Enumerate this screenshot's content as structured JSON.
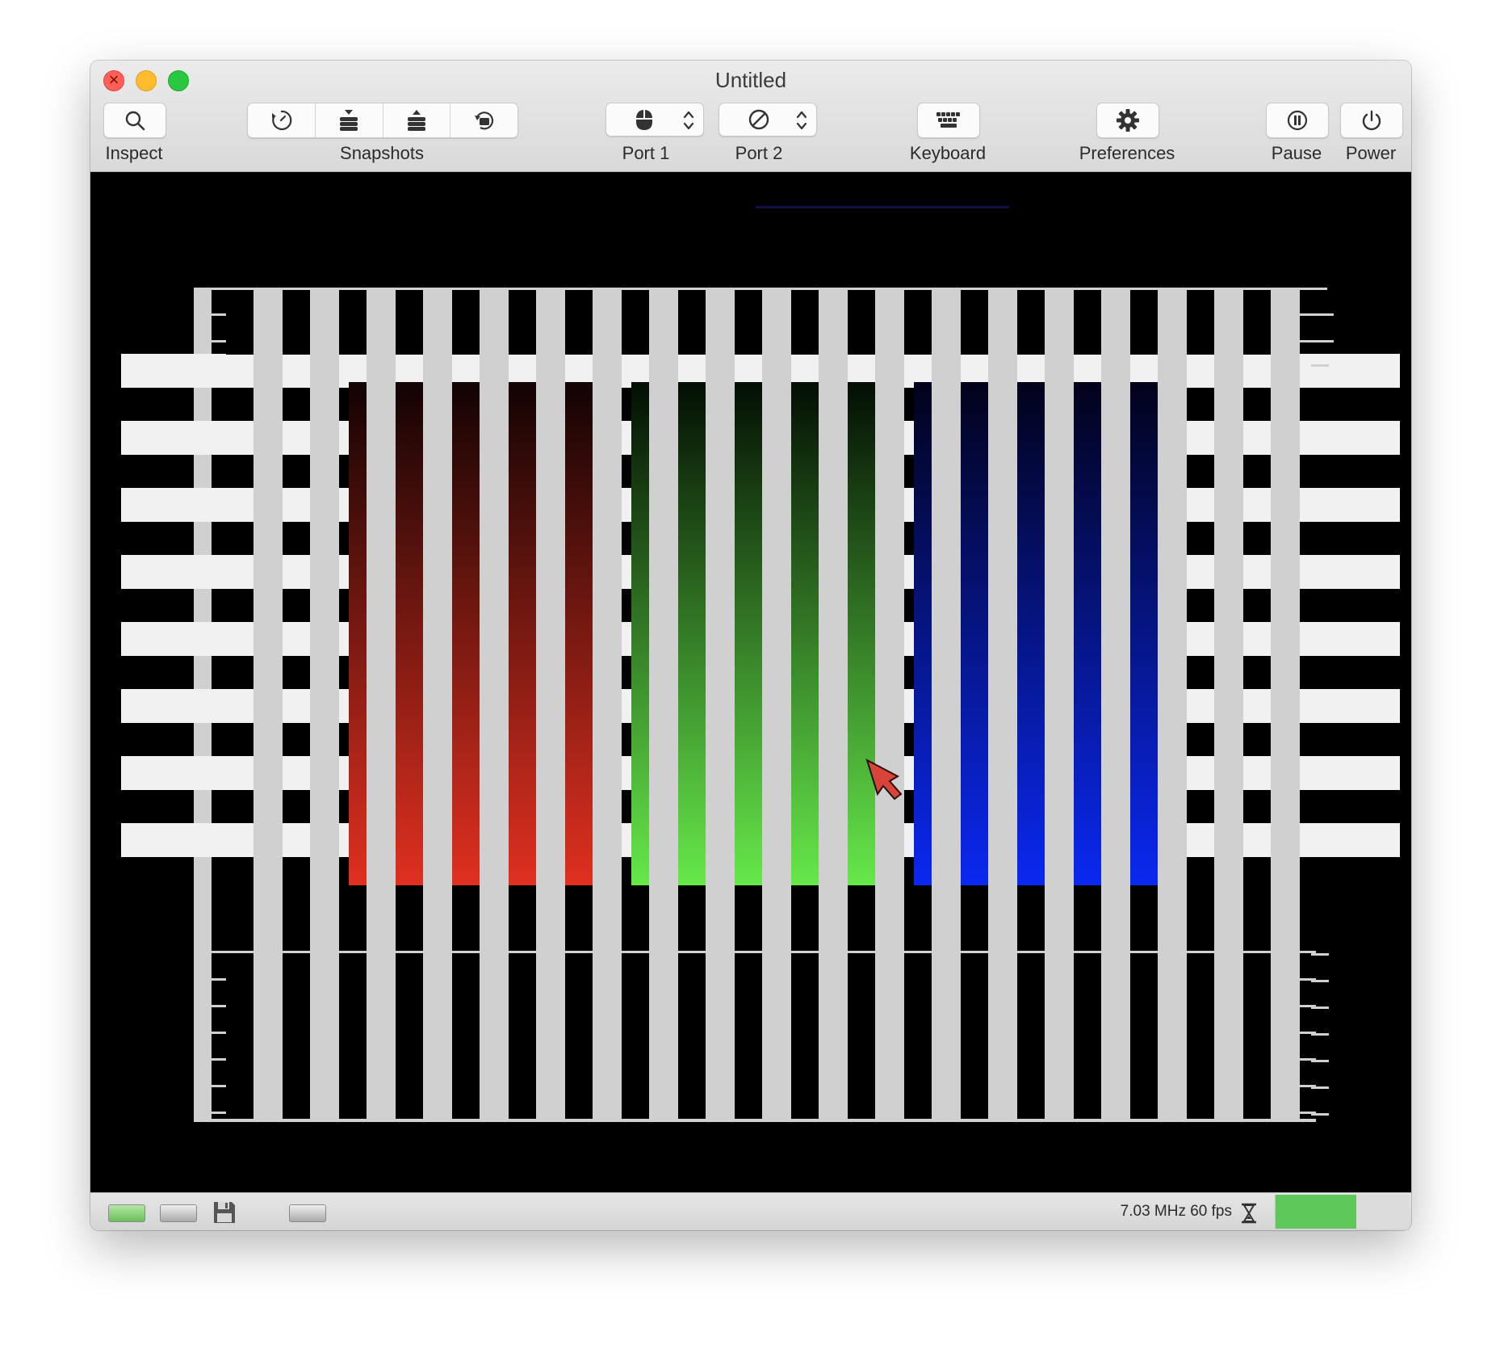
{
  "window": {
    "title": "Untitled"
  },
  "toolbar": {
    "inspect_label": "Inspect",
    "snapshots_label": "Snapshots",
    "port1_label": "Port 1",
    "port2_label": "Port 2",
    "keyboard_label": "Keyboard",
    "preferences_label": "Preferences",
    "pause_label": "Pause",
    "power_label": "Power",
    "snapshot_icons": [
      "snapshot-clock-icon",
      "snapshot-take-icon",
      "snapshot-restore-icon",
      "snapshot-browse-icon"
    ],
    "port1_icon": "mouse-icon",
    "port2_icon": "none-slash-icon"
  },
  "status": {
    "speed_text": "7.03 MHz 60 fps",
    "speed_level": 0.6,
    "drive_leds": [
      "on",
      "off"
    ],
    "colors": {
      "led_green": "#6cbf5a",
      "speed_fill": "#5ec85b"
    }
  },
  "screen": {
    "colors": {
      "background": "#000000",
      "bars_light": "#d0d0d0",
      "bars_white": "#f0f1f0",
      "red_bottom": "#e03020",
      "green_bottom": "#66e84a",
      "blue_bottom": "#0a28f0"
    },
    "pointer_icon": "mouse-pointer-icon"
  }
}
